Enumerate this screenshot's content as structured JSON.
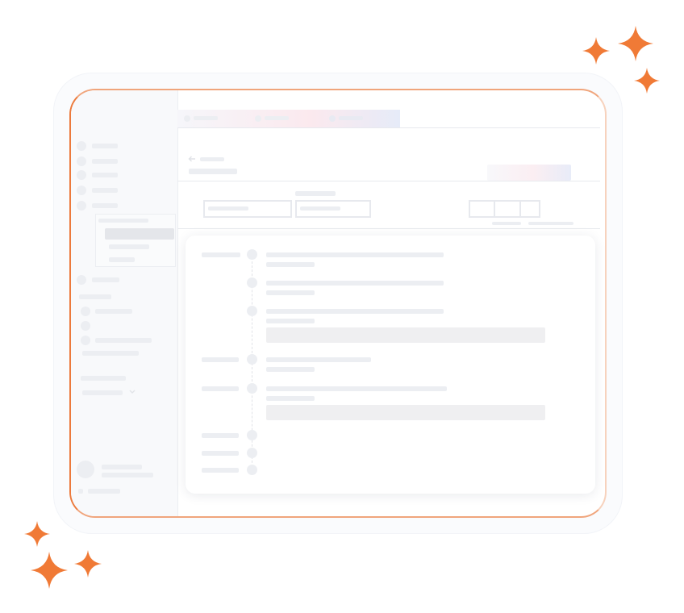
{
  "colors": {
    "accent": "#ec7a3c",
    "skeleton": "#eceef2"
  },
  "icons": [
    "back-arrow-icon",
    "chevron-down-icon",
    "sparkle-icon"
  ]
}
